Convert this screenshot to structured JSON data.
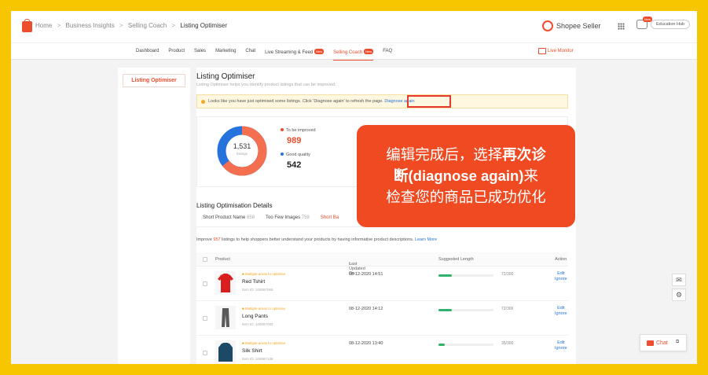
{
  "breadcrumb": {
    "items": [
      "Home",
      "Business Insights",
      "Selling Coach",
      "Listing Optimiser"
    ],
    "sep": ">"
  },
  "header": {
    "brand": "Shopee Seller",
    "education_badge": "New",
    "education_label": "Education Hub"
  },
  "nav": {
    "items": [
      {
        "label": "Dashboard"
      },
      {
        "label": "Product"
      },
      {
        "label": "Sales"
      },
      {
        "label": "Marketing"
      },
      {
        "label": "Chat"
      },
      {
        "label": "Live Streaming & Feed",
        "badge": "New"
      },
      {
        "label": "Selling Coach",
        "badge": "New"
      },
      {
        "label": "FAQ"
      }
    ],
    "live_monitor": "Live Monitor"
  },
  "sidebar": {
    "active_item": "Listing Optimiser"
  },
  "main": {
    "title": "Listing Optimiser",
    "subtitle": "Listing Optimiser helps you identify product listings that can be improved.",
    "tip_text": "Looks like you have just optimised some listings. Click 'Diagnose again' to refresh the page.",
    "tip_link": "Diagnose again",
    "total_listings": "1,531",
    "total_listings_label": "listings",
    "to_be_improved_label": "To be improved",
    "to_be_improved_value": "989",
    "to_be_improved_ratio": 0.646,
    "good_quality_label": "Good quality",
    "good_quality_value": "542",
    "details_title": "Listing Optimisation Details",
    "tabs": [
      {
        "label": "Short Product Name",
        "count": "658"
      },
      {
        "label": "Too Few Images",
        "count": "759"
      },
      {
        "label": "Short Ba",
        "count": ""
      }
    ],
    "improve_prefix": "Improve",
    "improve_count": "957",
    "improve_suffix": "listings to help shoppers better understand your products by having informative product descriptions.",
    "improve_link": "Learn More",
    "table": {
      "headers": {
        "product": "Product",
        "updated": "Last Updated On",
        "updated_sort": "↕",
        "length": "Suggested Length",
        "action": "Action"
      },
      "rows": [
        {
          "warning": "Multiple areas to optimise",
          "name": "Red Tshirt",
          "item_id": "Item ID: 100087065",
          "date": "08-12-2020 14:51",
          "length_text": "72/300",
          "length_ratio": 0.24,
          "edit": "Edit",
          "ignore": "Ignore"
        },
        {
          "warning": "Multiple areas to optimise",
          "name": "Long Pants",
          "item_id": "Item ID: 100087063",
          "date": "08-12-2020 14:12",
          "length_text": "72/300",
          "length_ratio": 0.24,
          "edit": "Edit",
          "ignore": "Ignore"
        },
        {
          "warning": "Multiple areas to optimise",
          "name": "Silk Shirt",
          "item_id": "Item ID: 100087138",
          "date": "08-12-2020 13:40",
          "length_text": "35/300",
          "length_ratio": 0.12,
          "edit": "Edit",
          "ignore": "Ignore"
        }
      ]
    }
  },
  "callout": {
    "line1_pre": "编辑完成后，选择",
    "line1_bold": "再次诊",
    "line2_bold": "断(diagnose again)",
    "line2_post": "来",
    "line3": "检查您的商品已成功优化"
  },
  "floating": {
    "chat_label": "Chat"
  },
  "colors": {
    "accent": "#ee4d2d",
    "link": "#2673dd",
    "frame": "#f7c600",
    "progress": "#2fb36c"
  }
}
